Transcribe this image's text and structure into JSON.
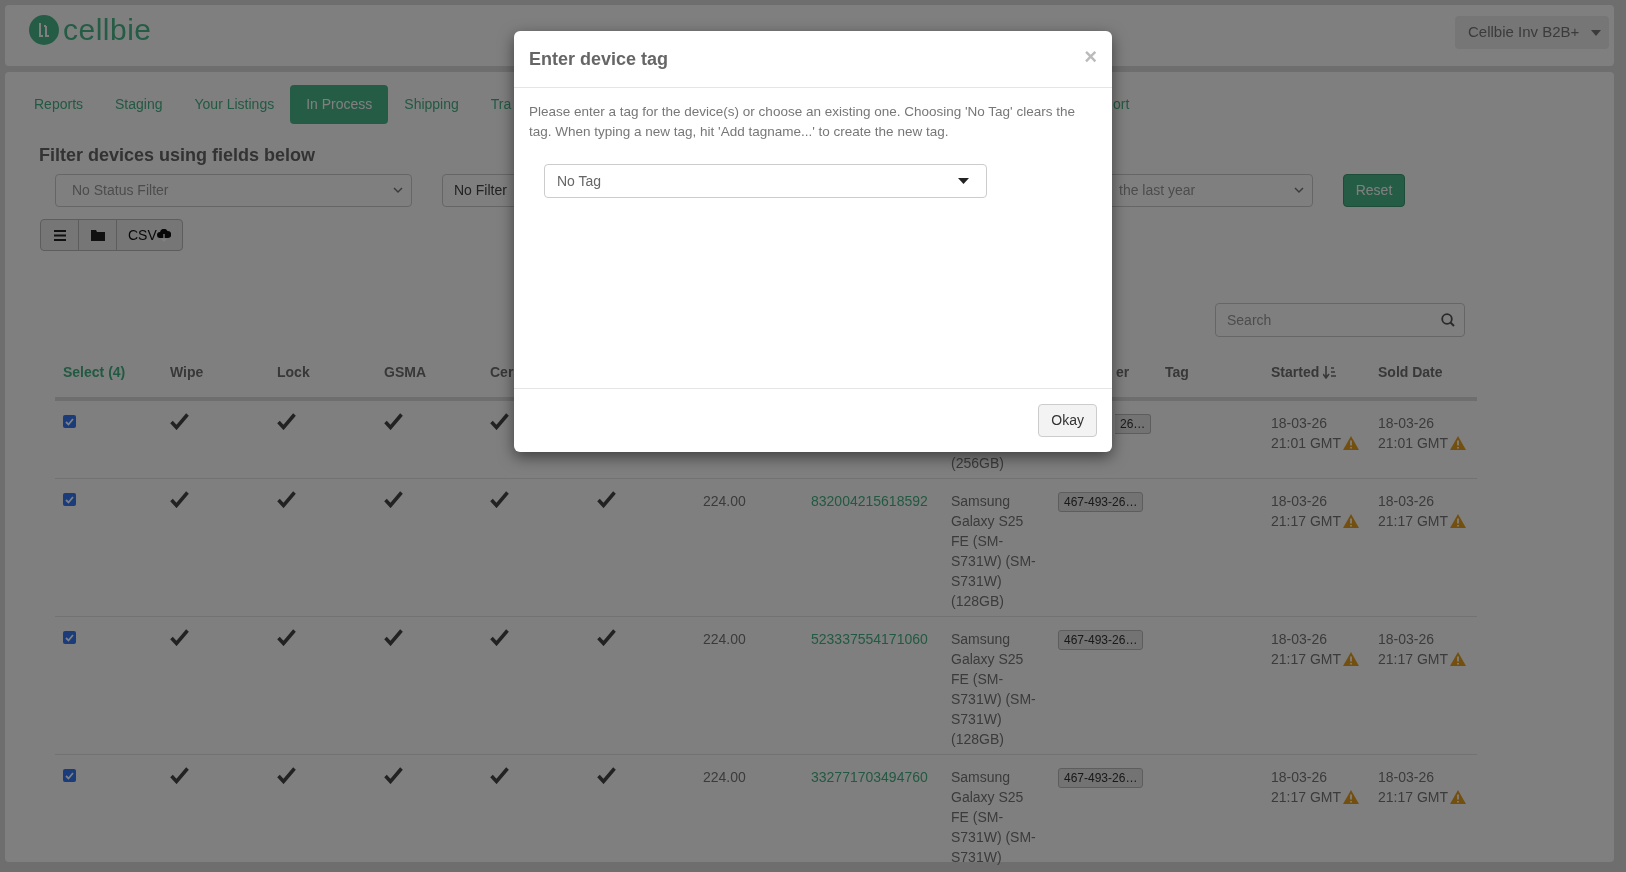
{
  "header": {
    "logo_text": "cellbie",
    "account_menu": "Cellbie Inv B2B+"
  },
  "tabs": [
    {
      "label": "Reports",
      "selected": false
    },
    {
      "label": "Staging",
      "selected": false
    },
    {
      "label": "Your Listings",
      "selected": false
    },
    {
      "label": "In Process",
      "selected": true
    },
    {
      "label": "Shipping",
      "selected": false
    },
    {
      "label": "Tra",
      "selected": false
    },
    {
      "label": "ort",
      "selected": false
    }
  ],
  "filters": {
    "heading": "Filter devices using fields below",
    "status_filter": "No Status Filter",
    "filter_2": "No Filter",
    "date_filter": "the last year",
    "reset": "Reset"
  },
  "toolbar": {
    "csv_label": "CSV"
  },
  "search": {
    "placeholder": "Search"
  },
  "table": {
    "columns": [
      "Select (4)",
      "Wipe",
      "Lock",
      "GSMA",
      "Cer",
      "",
      "",
      "",
      "",
      "er",
      "Tag",
      "Started",
      "Sold Date"
    ],
    "rows": [
      {
        "selected": true,
        "checks": [
          true,
          true,
          true,
          true
        ],
        "price": "",
        "imei": "",
        "model": "(256GB)",
        "tag_chip": "26…",
        "started": [
          "18-03-26",
          "21:01 GMT"
        ],
        "started_warning": true,
        "sold": [
          "18-03-26",
          "21:01 GMT"
        ],
        "sold_warning": true
      },
      {
        "selected": true,
        "checks": [
          true,
          true,
          true,
          true,
          true
        ],
        "price": "224.00",
        "imei": "832004215618592",
        "model": "Samsung Galaxy S25 FE (SM-S731W) (SM-S731W) (128GB)",
        "tag_chip": "467-493-26…",
        "started": [
          "18-03-26",
          "21:17 GMT"
        ],
        "started_warning": true,
        "sold": [
          "18-03-26",
          "21:17 GMT"
        ],
        "sold_warning": true
      },
      {
        "selected": true,
        "checks": [
          true,
          true,
          true,
          true,
          true
        ],
        "price": "224.00",
        "imei": "523337554171060",
        "model": "Samsung Galaxy S25 FE (SM-S731W) (SM-S731W) (128GB)",
        "tag_chip": "467-493-26…",
        "started": [
          "18-03-26",
          "21:17 GMT"
        ],
        "started_warning": true,
        "sold": [
          "18-03-26",
          "21:17 GMT"
        ],
        "sold_warning": true
      },
      {
        "selected": true,
        "checks": [
          true,
          true,
          true,
          true,
          true
        ],
        "price": "224.00",
        "imei": "332771703494760",
        "model": "Samsung Galaxy S25 FE (SM-S731W) (SM-S731W)",
        "tag_chip": "467-493-26…",
        "started": [
          "18-03-26",
          "21:17 GMT"
        ],
        "started_warning": true,
        "sold": [
          "18-03-26",
          "21:17 GMT"
        ],
        "sold_warning": true
      }
    ]
  },
  "modal": {
    "title": "Enter device tag",
    "close": "×",
    "message": "Please enter a tag for the device(s) or choose an existing one. Choosing 'No Tag' clears the tag. When typing a new tag, hit 'Add tagname...' to create the new tag.",
    "tag_select": "No Tag",
    "ok_button": "Okay"
  }
}
